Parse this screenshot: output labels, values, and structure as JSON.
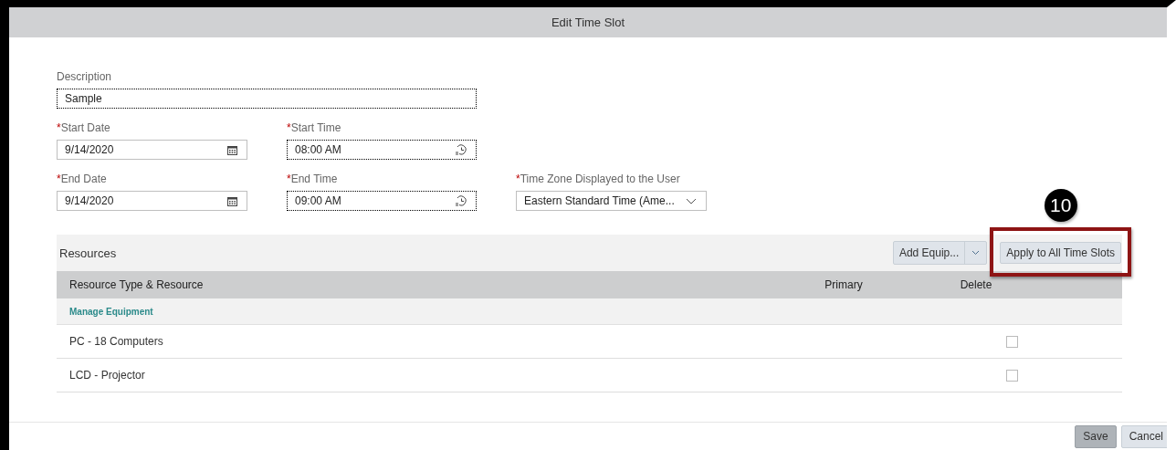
{
  "dialog": {
    "title": "Edit Time Slot"
  },
  "form_rows": [
    [
      {
        "kind": "text",
        "label": "Description",
        "value": "Sample",
        "focused": true
      }
    ],
    [
      {
        "kind": "date",
        "label": "Start Date",
        "required_mark": "*",
        "value": "9/14/2020",
        "focused": false
      },
      {
        "kind": "time",
        "label": "Start Time",
        "required_mark": "*",
        "value": "08:00 AM",
        "focused": true
      }
    ],
    [
      {
        "kind": "date",
        "label": "End Date",
        "required_mark": "*",
        "value": "9/14/2020",
        "focused": false
      },
      {
        "kind": "time",
        "label": "End Time",
        "required_mark": "*",
        "value": "09:00 AM",
        "focused": true
      },
      {
        "kind": "select",
        "label": "Time Zone Displayed to the User",
        "required_mark": "*",
        "value": "Eastern Standard Time (Ame...",
        "focused": false
      }
    ]
  ],
  "resources": {
    "title": "Resources",
    "add_button": {
      "label": "Add Equip..."
    },
    "apply_button": {
      "label": "Apply to All Time Slots",
      "highlighted": true
    },
    "step_badge": "10",
    "columns": [
      "Resource Type & Resource",
      "Primary",
      "Delete"
    ],
    "group": "Manage Equipment",
    "rows": [
      {
        "name": "PC - 18 Computers",
        "delete": false
      },
      {
        "name": "LCD - Projector",
        "delete": false
      }
    ]
  },
  "footer": [
    {
      "label": "Save",
      "kind": "primary"
    },
    {
      "label": "Cancel",
      "kind": "secondary"
    }
  ]
}
